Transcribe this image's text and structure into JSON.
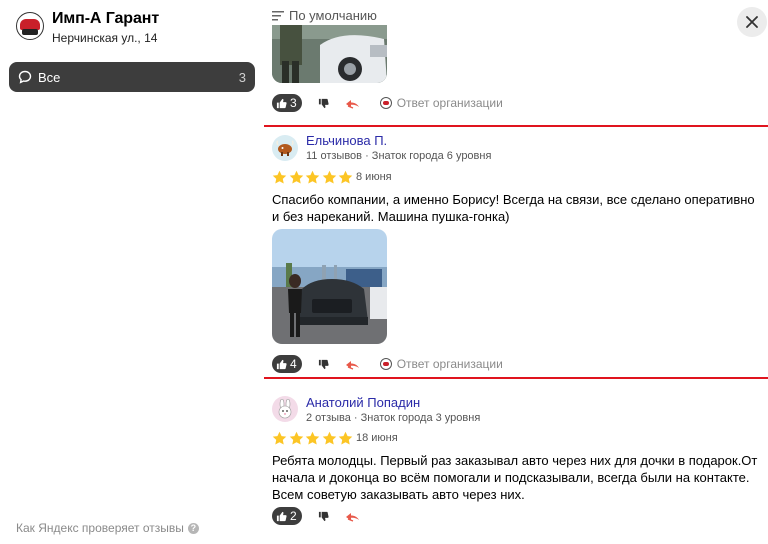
{
  "organization": {
    "name": "Имп-А Гарант",
    "address": "Нерчинская ул., 14"
  },
  "filter_tab": {
    "label": "Все",
    "count": "3"
  },
  "sort": {
    "label": "По умолчанию"
  },
  "footer_link": {
    "label": "Как Яндекс проверяет отзывы",
    "icon": "question-icon"
  },
  "previous_review": {
    "likes": "3",
    "reply_label": "Ответ организации"
  },
  "reviews": [
    {
      "author": "Ельчинова П.",
      "meta": "11 отзывов · Знаток города 6 уровня",
      "rating": 5,
      "date": "8 июня",
      "text": "Спасибо компании, а именно Борису! Всегда на связи, все сделано оперативно и без нареканий. Машина пушка-гонка)",
      "likes": "4",
      "reply_label": "Ответ организации",
      "avatar_icon": "bull-icon",
      "highlighted": true
    },
    {
      "author": "Анатолий Попадин",
      "meta": "2 отзыва · Знаток города 3 уровня",
      "rating": 5,
      "date": "18 июня",
      "text": "Ребята молодцы. Первый раз заказывал авто через них для дочки в подарок.От начала и доконца во всём помогали и подсказывали, всегда были на контакте. Всем советую заказывать авто через них.",
      "likes": "2",
      "avatar_icon": "bunny-icon"
    }
  ],
  "colors": {
    "star": "#fcc525",
    "author_link": "#2b2ba8",
    "highlight_border": "#e0141e",
    "dark_pill": "#3d3d3d"
  }
}
